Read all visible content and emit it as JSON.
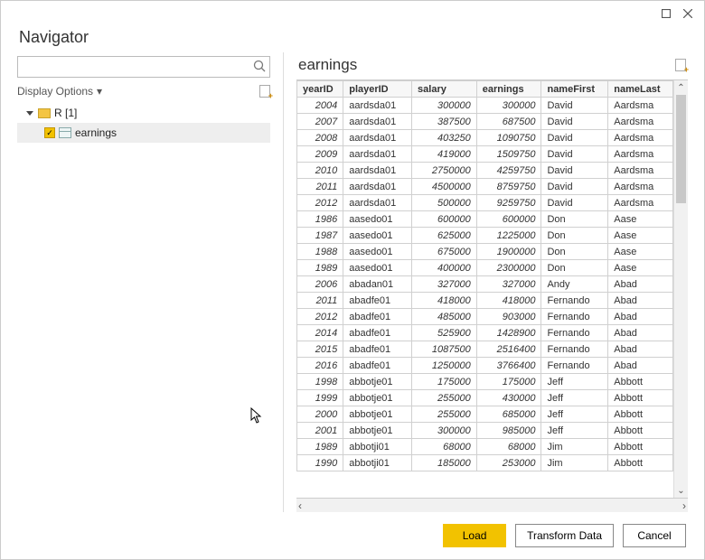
{
  "window": {
    "title": "Navigator"
  },
  "search": {
    "value": "",
    "placeholder": ""
  },
  "sidebar": {
    "display_options_label": "Display Options",
    "tree": {
      "root": {
        "label": "R [1]"
      },
      "item": {
        "label": "earnings",
        "checked": true
      }
    }
  },
  "preview": {
    "title": "earnings",
    "columns": [
      "yearID",
      "playerID",
      "salary",
      "earnings",
      "nameFirst",
      "nameLast"
    ],
    "rows": [
      {
        "yearID": "2004",
        "playerID": "aardsda01",
        "salary": "300000",
        "earnings": "300000",
        "nameFirst": "David",
        "nameLast": "Aardsma"
      },
      {
        "yearID": "2007",
        "playerID": "aardsda01",
        "salary": "387500",
        "earnings": "687500",
        "nameFirst": "David",
        "nameLast": "Aardsma"
      },
      {
        "yearID": "2008",
        "playerID": "aardsda01",
        "salary": "403250",
        "earnings": "1090750",
        "nameFirst": "David",
        "nameLast": "Aardsma"
      },
      {
        "yearID": "2009",
        "playerID": "aardsda01",
        "salary": "419000",
        "earnings": "1509750",
        "nameFirst": "David",
        "nameLast": "Aardsma"
      },
      {
        "yearID": "2010",
        "playerID": "aardsda01",
        "salary": "2750000",
        "earnings": "4259750",
        "nameFirst": "David",
        "nameLast": "Aardsma"
      },
      {
        "yearID": "2011",
        "playerID": "aardsda01",
        "salary": "4500000",
        "earnings": "8759750",
        "nameFirst": "David",
        "nameLast": "Aardsma"
      },
      {
        "yearID": "2012",
        "playerID": "aardsda01",
        "salary": "500000",
        "earnings": "9259750",
        "nameFirst": "David",
        "nameLast": "Aardsma"
      },
      {
        "yearID": "1986",
        "playerID": "aasedo01",
        "salary": "600000",
        "earnings": "600000",
        "nameFirst": "Don",
        "nameLast": "Aase"
      },
      {
        "yearID": "1987",
        "playerID": "aasedo01",
        "salary": "625000",
        "earnings": "1225000",
        "nameFirst": "Don",
        "nameLast": "Aase"
      },
      {
        "yearID": "1988",
        "playerID": "aasedo01",
        "salary": "675000",
        "earnings": "1900000",
        "nameFirst": "Don",
        "nameLast": "Aase"
      },
      {
        "yearID": "1989",
        "playerID": "aasedo01",
        "salary": "400000",
        "earnings": "2300000",
        "nameFirst": "Don",
        "nameLast": "Aase"
      },
      {
        "yearID": "2006",
        "playerID": "abadan01",
        "salary": "327000",
        "earnings": "327000",
        "nameFirst": "Andy",
        "nameLast": "Abad"
      },
      {
        "yearID": "2011",
        "playerID": "abadfe01",
        "salary": "418000",
        "earnings": "418000",
        "nameFirst": "Fernando",
        "nameLast": "Abad"
      },
      {
        "yearID": "2012",
        "playerID": "abadfe01",
        "salary": "485000",
        "earnings": "903000",
        "nameFirst": "Fernando",
        "nameLast": "Abad"
      },
      {
        "yearID": "2014",
        "playerID": "abadfe01",
        "salary": "525900",
        "earnings": "1428900",
        "nameFirst": "Fernando",
        "nameLast": "Abad"
      },
      {
        "yearID": "2015",
        "playerID": "abadfe01",
        "salary": "1087500",
        "earnings": "2516400",
        "nameFirst": "Fernando",
        "nameLast": "Abad"
      },
      {
        "yearID": "2016",
        "playerID": "abadfe01",
        "salary": "1250000",
        "earnings": "3766400",
        "nameFirst": "Fernando",
        "nameLast": "Abad"
      },
      {
        "yearID": "1998",
        "playerID": "abbotje01",
        "salary": "175000",
        "earnings": "175000",
        "nameFirst": "Jeff",
        "nameLast": "Abbott"
      },
      {
        "yearID": "1999",
        "playerID": "abbotje01",
        "salary": "255000",
        "earnings": "430000",
        "nameFirst": "Jeff",
        "nameLast": "Abbott"
      },
      {
        "yearID": "2000",
        "playerID": "abbotje01",
        "salary": "255000",
        "earnings": "685000",
        "nameFirst": "Jeff",
        "nameLast": "Abbott"
      },
      {
        "yearID": "2001",
        "playerID": "abbotje01",
        "salary": "300000",
        "earnings": "985000",
        "nameFirst": "Jeff",
        "nameLast": "Abbott"
      },
      {
        "yearID": "1989",
        "playerID": "abbotji01",
        "salary": "68000",
        "earnings": "68000",
        "nameFirst": "Jim",
        "nameLast": "Abbott"
      },
      {
        "yearID": "1990",
        "playerID": "abbotji01",
        "salary": "185000",
        "earnings": "253000",
        "nameFirst": "Jim",
        "nameLast": "Abbott"
      }
    ]
  },
  "footer": {
    "load_label": "Load",
    "transform_label": "Transform Data",
    "cancel_label": "Cancel"
  }
}
